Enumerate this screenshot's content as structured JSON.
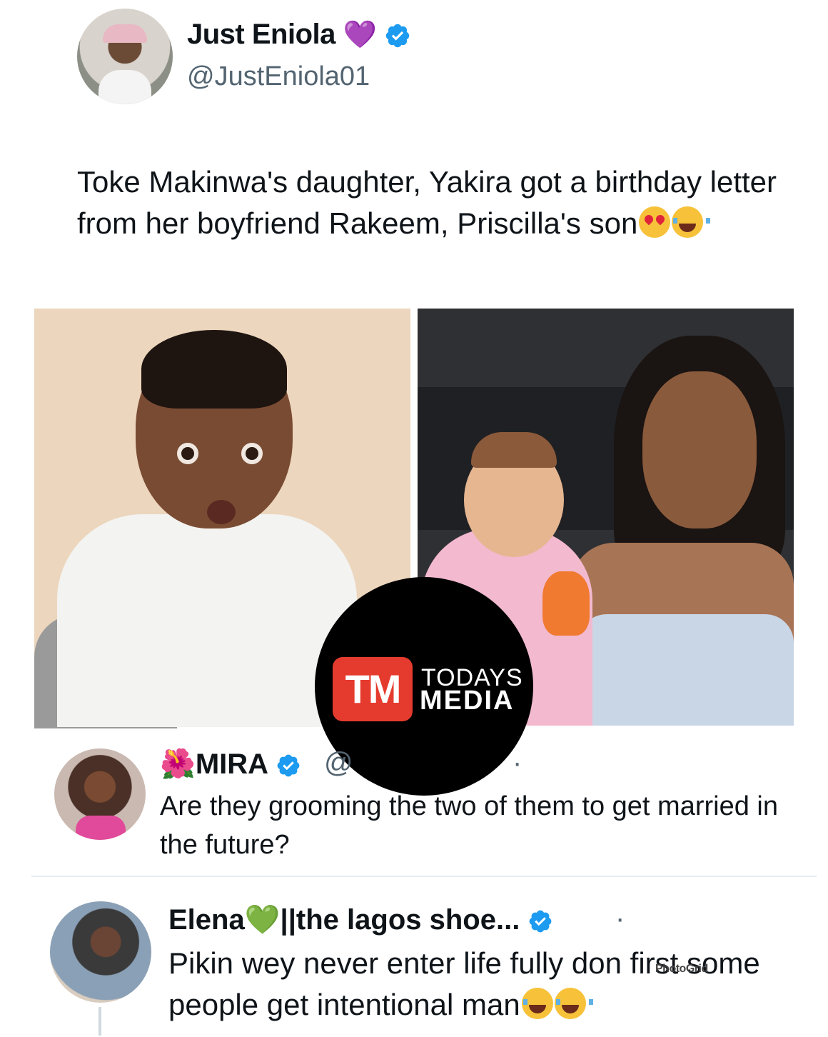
{
  "main_tweet": {
    "name": "Just Eniola",
    "name_emoji": "💜",
    "handle": "@JustEniola01",
    "text": "Toke Makinwa's daughter, Yakira got a birthday letter from her boyfriend Rakeem, Priscilla's son",
    "emojis": [
      "heart-eyes-emoji",
      "tears-of-joy-emoji"
    ]
  },
  "watermark": {
    "badge": "TM",
    "line1": "TODAYS",
    "line2": "MEDIA"
  },
  "reply_1": {
    "name_prefix_emoji": "🌺",
    "name": "MIRA",
    "handle": "@",
    "dot": "·",
    "text": "Are they grooming the two of them to get married in the future?"
  },
  "reply_2": {
    "name": "Elena",
    "name_emoji": "💚",
    "name_suffix": "||the lagos shoe...",
    "dot": "·",
    "text": "Pikin wey never enter life fully don first some people get intentional man",
    "emojis": [
      "tears-of-joy-emoji",
      "tears-of-joy-emoji"
    ]
  },
  "overlay": {
    "photogrid": "PhotoGrid"
  },
  "colors": {
    "verified": "#1d9bf0",
    "handle": "#536471",
    "watermark_badge": "#e53b2e"
  }
}
